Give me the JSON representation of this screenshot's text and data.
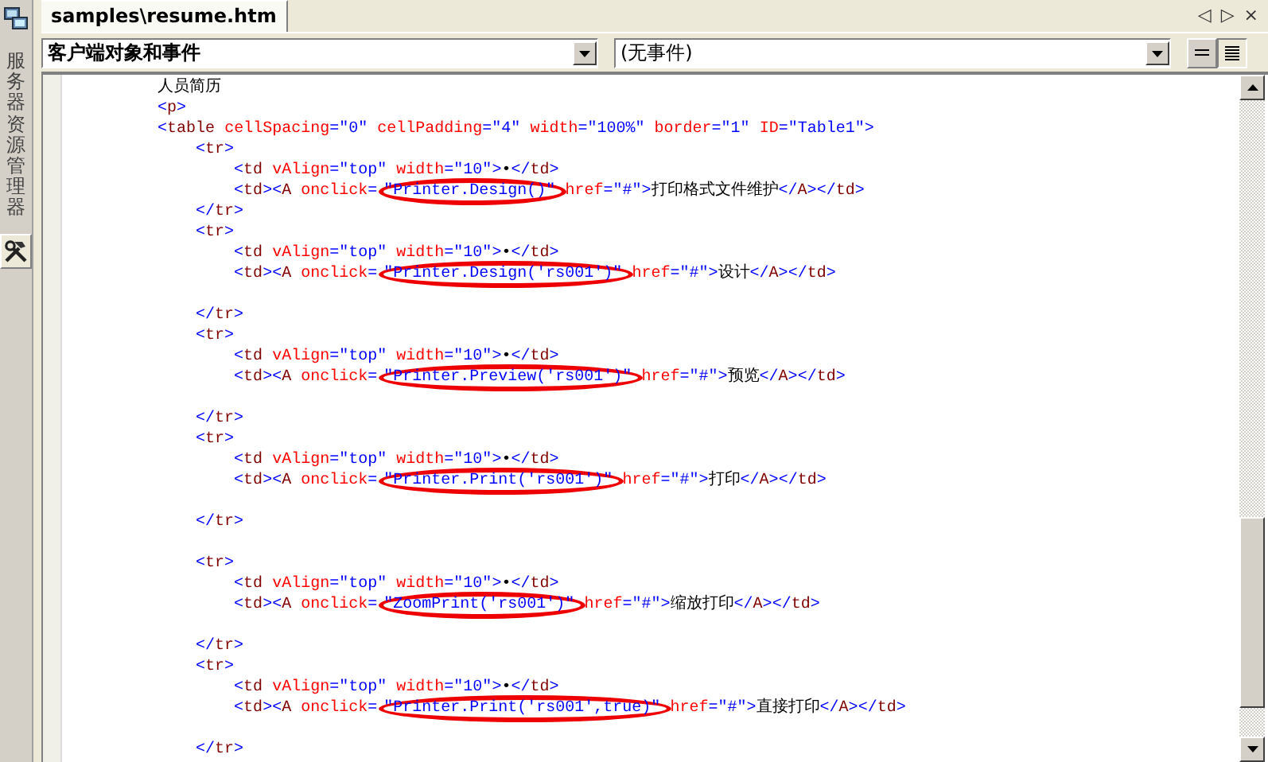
{
  "side_panel": {
    "tabs": [
      {
        "kind": "icon",
        "selected": false
      },
      {
        "kind": "label",
        "label": "服务器资源管理器",
        "selected": false
      },
      {
        "kind": "icon",
        "selected": true
      }
    ]
  },
  "document_tab": {
    "title": "samples\\resume.htm"
  },
  "tab_controls": [
    "◁",
    "▷",
    "×"
  ],
  "object_dropdown": {
    "value": "客户端对象和事件"
  },
  "event_dropdown": {
    "value": "(无事件)"
  },
  "view_buttons": [
    {
      "kind": "left",
      "selected": false
    },
    {
      "kind": "justify",
      "selected": true
    }
  ],
  "code_lines": [
    {
      "kind": "code",
      "text": "          人员简历"
    },
    {
      "kind": "code",
      "text": "          <p>"
    },
    {
      "kind": "code",
      "text": "          <table cellSpacing=\"0\" cellPadding=\"4\" width=\"100%\" border=\"1\" ID=\"Table1\">"
    },
    {
      "kind": "code",
      "text": "              <tr>"
    },
    {
      "kind": "code",
      "text": "                  <td vAlign=\"top\" width=\"10\">•</td>"
    },
    {
      "kind": "code",
      "text": "                  <td><A onclick=",
      "circled": "\"Printer.Design()\"",
      "after": " href=\"#\">打印格式文件维护</A></td>"
    },
    {
      "kind": "code",
      "text": "              </tr>"
    },
    {
      "kind": "code",
      "text": "              <tr>"
    },
    {
      "kind": "code",
      "text": "                  <td vAlign=\"top\" width=\"10\">•</td>"
    },
    {
      "kind": "code",
      "text": "                  <td><A onclick=",
      "circled": "\"Printer.Design('rs001')\"",
      "after": " href=\"#\">设计</A></td>"
    },
    {
      "kind": "blank"
    },
    {
      "kind": "code",
      "text": "              </tr>"
    },
    {
      "kind": "code",
      "text": "              <tr>"
    },
    {
      "kind": "code",
      "text": "                  <td vAlign=\"top\" width=\"10\">•</td>"
    },
    {
      "kind": "code",
      "text": "                  <td><A onclick=",
      "circled": "\"Printer.Preview('rs001')\"",
      "after": " href=\"#\">预览</A></td>"
    },
    {
      "kind": "blank"
    },
    {
      "kind": "code",
      "text": "              </tr>"
    },
    {
      "kind": "code",
      "text": "              <tr>"
    },
    {
      "kind": "code",
      "text": "                  <td vAlign=\"top\" width=\"10\">•</td>"
    },
    {
      "kind": "code",
      "text": "                  <td><A onclick=",
      "circled": "\"Printer.Print('rs001')\"",
      "after": " href=\"#\">打印</A></td>"
    },
    {
      "kind": "blank"
    },
    {
      "kind": "code",
      "text": "              </tr>"
    },
    {
      "kind": "blank"
    },
    {
      "kind": "code",
      "text": "              <tr>"
    },
    {
      "kind": "code",
      "text": "                  <td vAlign=\"top\" width=\"10\">•</td>"
    },
    {
      "kind": "code",
      "text": "                  <td><A onclick=",
      "circled": "\"ZoomPrint('rs001')\"",
      "after": " href=\"#\">缩放打印</A></td>"
    },
    {
      "kind": "blank"
    },
    {
      "kind": "code",
      "text": "              </tr>"
    },
    {
      "kind": "code",
      "text": "              <tr>"
    },
    {
      "kind": "code",
      "text": "                  <td vAlign=\"top\" width=\"10\">•</td>"
    },
    {
      "kind": "code",
      "text": "                  <td><A onclick=",
      "circled": "\"Printer.Print('rs001',true)\"",
      "after": " href=\"#\">直接打印</A></td>"
    },
    {
      "kind": "blank"
    },
    {
      "kind": "code",
      "text": "              </tr>"
    }
  ]
}
